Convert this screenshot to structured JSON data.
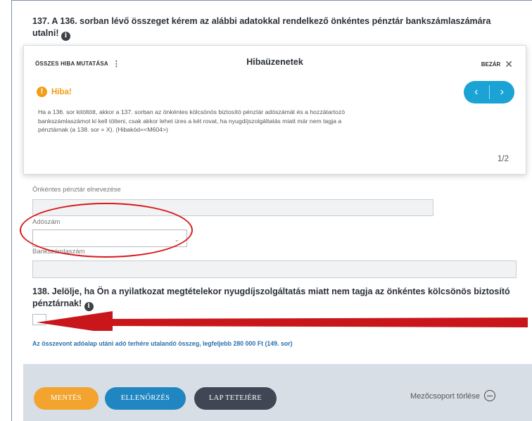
{
  "question_137": {
    "text": "137. A 136. sorban lévő összeget kérem az alábbi adatokkal rendelkező önkéntes pénztár bankszámlaszámára utalni!",
    "info_icon_glyph": "i"
  },
  "error_panel": {
    "show_all_label": "ÖSSZES HIBA MUTATÁSA",
    "menu_glyph": "⋮",
    "title": "Hibaüzenetek",
    "close_label": "BEZÁR",
    "close_glyph": "✕",
    "warning_glyph": "!",
    "warning_label": "Hiba!",
    "message": "Ha a 136. sor kitöltött, akkor a 137. sorban az önkéntes kölcsönös biztosító pénztár adószámát és a hozzátartozó bankszámlaszámot ki kell tölteni, csak akkor lehet üres a két rovat, ha nyugdíjszolgáltatás miatt már nem tagja a pénztárnak (a 138. sor = X). (Hibakód=<M604>)",
    "prev_glyph": "‹",
    "next_glyph": "›",
    "counter": "1/2",
    "accent_color": "#1aa3d4",
    "warning_color": "#f29d16"
  },
  "fields": {
    "fund_name_label": "Önkéntes pénztár elnevezése",
    "fund_name_value": "",
    "tax_number_label": "Adószám",
    "tax_number_value": "",
    "tax_number_chevron": "⌄",
    "bank_account_label": "Bankszámlaszám",
    "bank_account_value": ""
  },
  "question_138": {
    "text": "138. Jelölje, ha Ön a nyilatkozat megtételekor nyugdíjszolgáltatás miatt nem tagja az önkéntes kölcsönös biztosító pénztárnak!",
    "info_icon_glyph": "i",
    "checked": false
  },
  "link_149": "Az összevont adóalap utáni adó terhére utalandó összeg, legfeljebb 280 000 Ft (149. sor)",
  "footer": {
    "save_label": "MENTÉS",
    "check_label": "ELLENŐRZÉS",
    "top_label": "LAP TETEJÉRE",
    "clear_group_label": "Mezőcsoport törlése"
  },
  "annotations": {
    "highlight_color": "#d8191b"
  }
}
